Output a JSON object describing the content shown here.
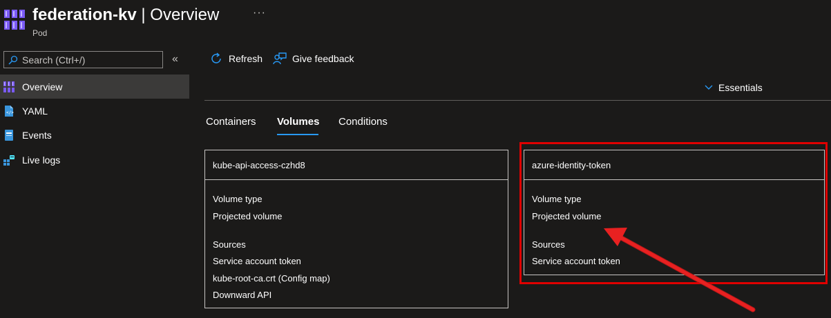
{
  "header": {
    "resource_name": "federation-kv",
    "separator": "|",
    "page": "Overview",
    "subtitle": "Pod",
    "more_label": "···"
  },
  "search": {
    "placeholder": "Search (Ctrl+/)",
    "collapse_label": "«"
  },
  "sidebar": {
    "items": [
      {
        "label": "Overview",
        "icon": "pod-icon",
        "active": true
      },
      {
        "label": "YAML",
        "icon": "yaml-file-icon"
      },
      {
        "label": "Events",
        "icon": "events-icon"
      },
      {
        "label": "Live logs",
        "icon": "live-logs-icon"
      }
    ]
  },
  "toolbar": {
    "refresh_label": "Refresh",
    "feedback_label": "Give feedback"
  },
  "essentials_label": "Essentials",
  "tabs": [
    {
      "label": "Containers"
    },
    {
      "label": "Volumes",
      "active": true
    },
    {
      "label": "Conditions"
    }
  ],
  "volumes": [
    {
      "name": "kube-api-access-czhd8",
      "volume_type_label": "Volume type",
      "volume_type": "Projected volume",
      "sources_label": "Sources",
      "sources": [
        "Service account token",
        "kube-root-ca.crt (Config map)",
        "Downward API"
      ]
    },
    {
      "name": "azure-identity-token",
      "volume_type_label": "Volume type",
      "volume_type": "Projected volume",
      "sources_label": "Sources",
      "sources": [
        "Service account token"
      ]
    }
  ],
  "colors": {
    "background": "#1b1a19",
    "accent": "#2899f5",
    "annotation": "#e00000",
    "active_nav": "#3b3a39"
  }
}
